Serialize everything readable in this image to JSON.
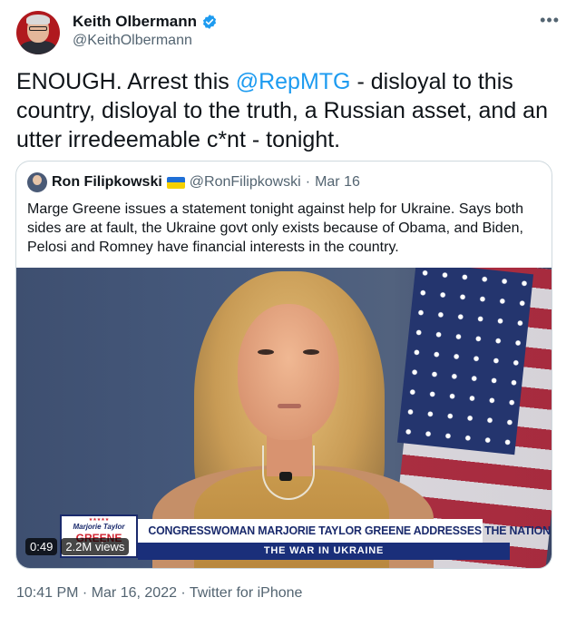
{
  "author": {
    "name": "Keith Olbermann",
    "handle": "@KeithOlbermann",
    "verified_icon": "verified-badge-icon"
  },
  "tweet": {
    "text_before": "ENOUGH. Arrest this ",
    "mention": "@RepMTG",
    "text_after": " - disloyal to this country, disloyal to the truth, a Russian asset, and an utter irredeemable c*nt - tonight."
  },
  "quoted": {
    "name": "Ron Filipkowski",
    "flag_icon": "ukraine-flag-icon",
    "handle": "@RonFilipkowski",
    "separator": "·",
    "date": "Mar 16",
    "text": "Marge Greene issues a statement tonight against help for Ukraine. Says both sides are at fault, the Ukraine govt only exists because of Obama, and Biden, Pelosi and Romney have financial interests in the country.",
    "video": {
      "duration": "0:49",
      "views": "2.2M views",
      "logo_top": "Marjorie Taylor",
      "logo_bottom": "GREENE",
      "headline": "CONGRESSWOMAN MARJORIE TAYLOR GREENE ADDRESSES THE NATION",
      "subline": "THE WAR IN UKRAINE"
    }
  },
  "footer": {
    "text": "10:41 PM · Mar 16, 2022 · Twitter for iPhone"
  },
  "colors": {
    "link": "#1d9bf0",
    "secondary_text": "#536471",
    "border": "#cfd9de"
  }
}
